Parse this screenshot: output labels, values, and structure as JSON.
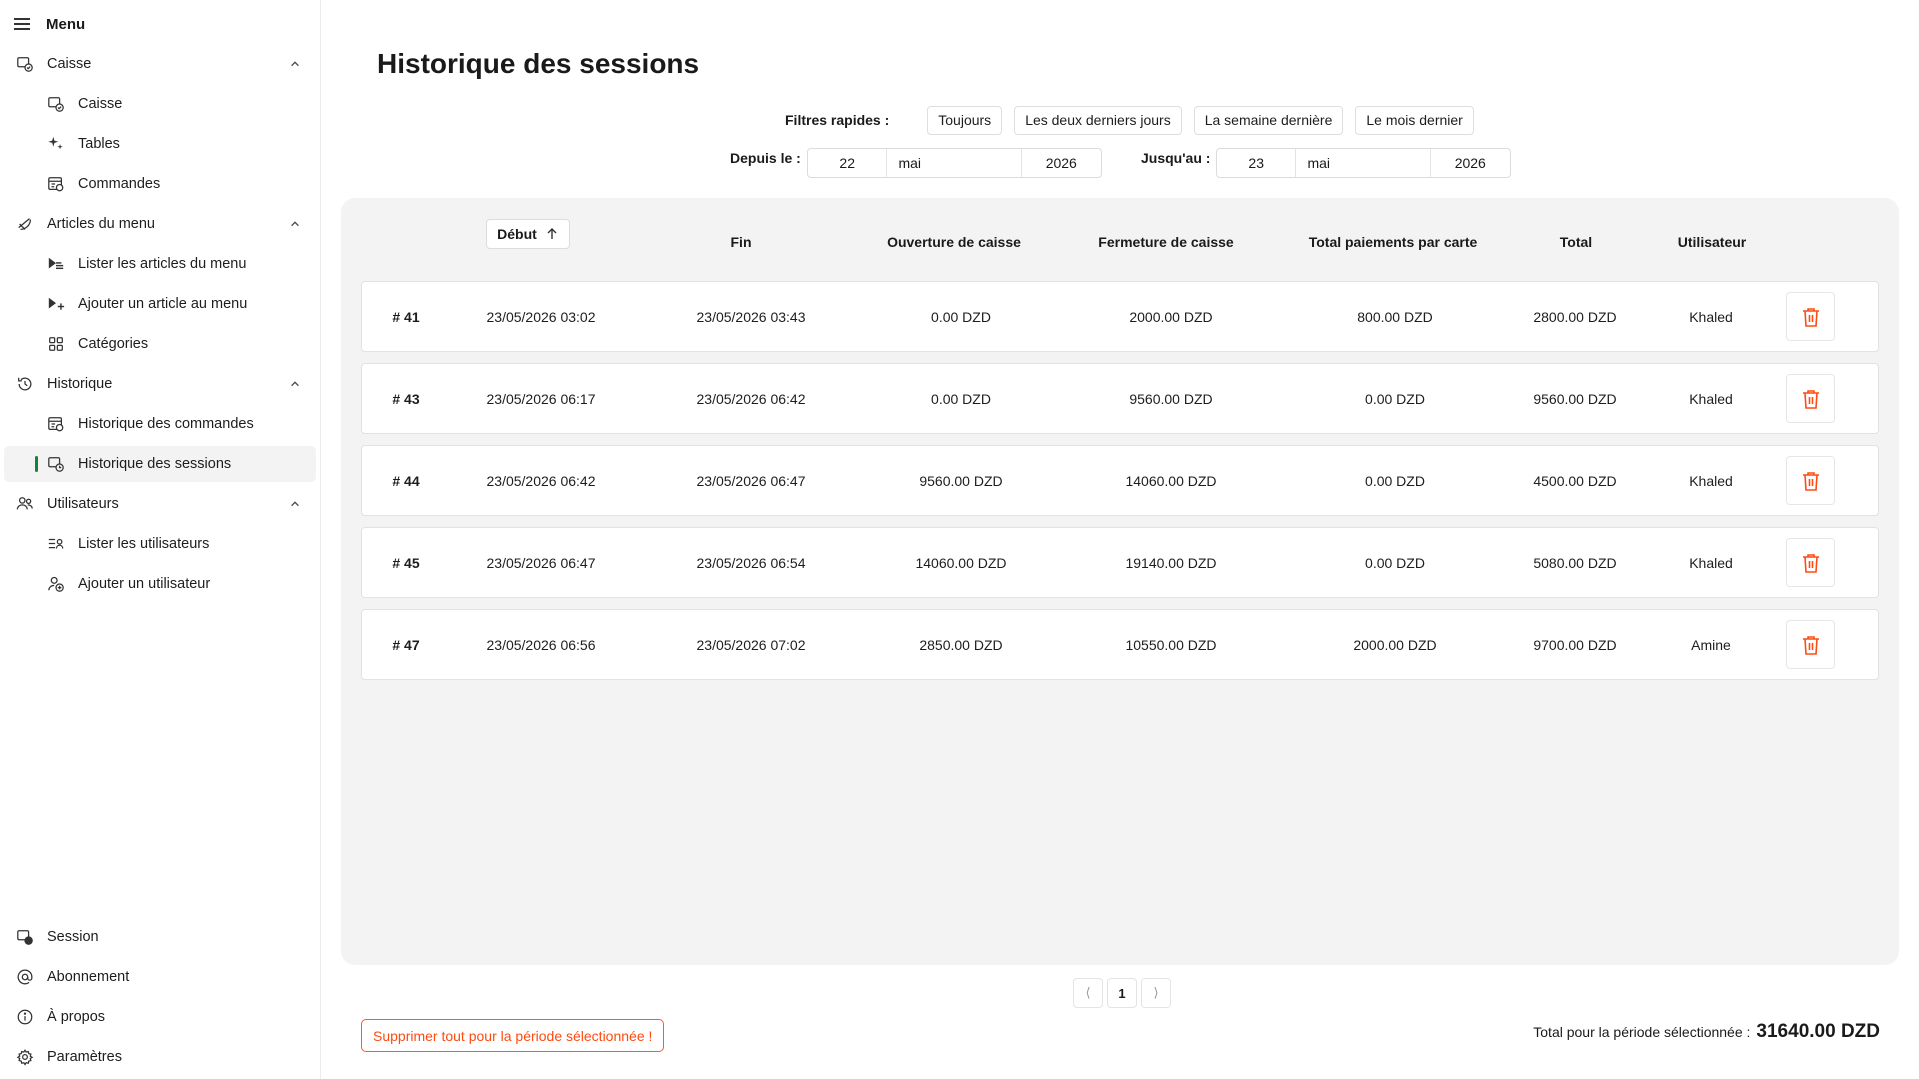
{
  "sidebar": {
    "menu_label": "Menu",
    "groups": [
      {
        "label": "Caisse",
        "icon": "cash-register-icon",
        "items": [
          {
            "label": "Caisse",
            "icon": "cash-register-icon"
          },
          {
            "label": "Tables",
            "icon": "sparkle-icon"
          },
          {
            "label": "Commandes",
            "icon": "orders-icon"
          }
        ]
      },
      {
        "label": "Articles du menu",
        "icon": "food-icon",
        "items": [
          {
            "label": "Lister les articles du menu",
            "icon": "list-food-icon"
          },
          {
            "label": "Ajouter un article au menu",
            "icon": "add-food-icon"
          },
          {
            "label": "Catégories",
            "icon": "grid-icon"
          }
        ]
      },
      {
        "label": "Historique",
        "icon": "history-icon",
        "items": [
          {
            "label": "Historique des commandes",
            "icon": "orders-icon"
          },
          {
            "label": "Historique des sessions",
            "icon": "cash-register-icon",
            "active": true
          }
        ]
      },
      {
        "label": "Utilisateurs",
        "icon": "users-icon",
        "items": [
          {
            "label": "Lister les utilisateurs",
            "icon": "list-users-icon"
          },
          {
            "label": "Ajouter un utilisateur",
            "icon": "add-user-icon"
          }
        ]
      }
    ],
    "footer": [
      {
        "label": "Session",
        "icon": "cash-register-icon"
      },
      {
        "label": "Abonnement",
        "icon": "at-icon"
      },
      {
        "label": "À propos",
        "icon": "info-icon"
      },
      {
        "label": "Paramètres",
        "icon": "gear-icon"
      }
    ]
  },
  "main": {
    "title": "Historique des sessions",
    "filters_label": "Filtres rapides :",
    "quick_filters": [
      "Toujours",
      "Les deux derniers jours",
      "La semaine dernière",
      "Le mois dernier"
    ],
    "from": {
      "label": "Depuis le :",
      "day": "22",
      "month": "mai",
      "year": "2026"
    },
    "to": {
      "label": "Jusqu'au :",
      "day": "23",
      "month": "mai",
      "year": "2026"
    }
  },
  "table": {
    "sort_label": "Début",
    "columns": {
      "end": "Fin",
      "opening": "Ouverture de caisse",
      "closing": "Fermeture de caisse",
      "card": "Total paiements par carte",
      "total": "Total",
      "user": "Utilisateur"
    },
    "rows": [
      {
        "id": "# 41",
        "start": "23/05/2026 03:02",
        "end": "23/05/2026 03:43",
        "opening": "0.00 DZD",
        "closing": "2000.00 DZD",
        "card": "800.00 DZD",
        "total": "2800.00 DZD",
        "user": "Khaled"
      },
      {
        "id": "# 43",
        "start": "23/05/2026 06:17",
        "end": "23/05/2026 06:42",
        "opening": "0.00 DZD",
        "closing": "9560.00 DZD",
        "card": "0.00 DZD",
        "total": "9560.00 DZD",
        "user": "Khaled"
      },
      {
        "id": "# 44",
        "start": "23/05/2026 06:42",
        "end": "23/05/2026 06:47",
        "opening": "9560.00 DZD",
        "closing": "14060.00 DZD",
        "card": "0.00 DZD",
        "total": "4500.00 DZD",
        "user": "Khaled"
      },
      {
        "id": "# 45",
        "start": "23/05/2026 06:47",
        "end": "23/05/2026 06:54",
        "opening": "14060.00 DZD",
        "closing": "19140.00 DZD",
        "card": "0.00 DZD",
        "total": "5080.00 DZD",
        "user": "Khaled"
      },
      {
        "id": "# 47",
        "start": "23/05/2026 06:56",
        "end": "23/05/2026 07:02",
        "opening": "2850.00 DZD",
        "closing": "10550.00 DZD",
        "card": "2000.00 DZD",
        "total": "9700.00 DZD",
        "user": "Amine"
      }
    ]
  },
  "pagination": {
    "prev": "⟨",
    "current": "1",
    "next": "⟩"
  },
  "footer": {
    "delete_all_label": "Supprimer tout pour la période sélectionnée !",
    "total_label": "Total pour la période sélectionnée :",
    "total_value": "31640.00 DZD"
  },
  "colors": {
    "accent_orange": "#ff4a10",
    "active_indicator": "#1a7f37",
    "panel_bg": "#f3f3f3"
  }
}
